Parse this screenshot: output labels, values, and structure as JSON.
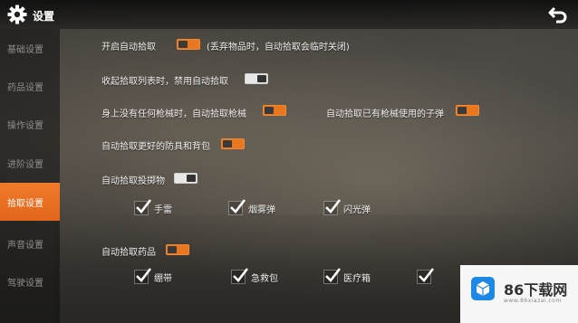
{
  "header": {
    "title": "设置"
  },
  "sidebar": {
    "items": [
      {
        "label": "基础设置",
        "active": false
      },
      {
        "label": "药品设置",
        "active": false
      },
      {
        "label": "操作设置",
        "active": false
      },
      {
        "label": "进阶设置",
        "active": false
      },
      {
        "label": "拾取设置",
        "active": true
      },
      {
        "label": "声音设置",
        "active": false
      },
      {
        "label": "驾驶设置",
        "active": false
      }
    ]
  },
  "settings": {
    "auto_pickup": {
      "label": "开启自动拾取",
      "state": "on",
      "note": "(丢弃物品时，自动拾取会临时关闭)"
    },
    "disable_when_list_collapsed": {
      "label": "收起拾取列表时，禁用自动拾取",
      "state": "off"
    },
    "auto_pickup_gun": {
      "label": "身上没有任何枪械时，自动拾取枪械",
      "state": "on"
    },
    "auto_pickup_ammo": {
      "label": "自动拾取已有枪械使用的子弹",
      "state": "on"
    },
    "auto_pickup_better_armor": {
      "label": "自动拾取更好的防具和背包",
      "state": "on"
    },
    "auto_pickup_throwables": {
      "label": "自动拾取投掷物",
      "state": "off",
      "options": [
        {
          "label": "手雷",
          "checked": true
        },
        {
          "label": "烟雾弹",
          "checked": true
        },
        {
          "label": "闪光弹",
          "checked": true
        }
      ]
    },
    "auto_pickup_medicine": {
      "label": "自动拾取药品",
      "state": "on",
      "options": [
        {
          "label": "绷带",
          "checked": true
        },
        {
          "label": "急救包",
          "checked": true
        },
        {
          "label": "医疗箱",
          "checked": true
        },
        {
          "label": "",
          "checked": true
        }
      ]
    }
  },
  "watermark": {
    "text": "86下载网",
    "sub": "www.86xiazai.com"
  },
  "colors": {
    "accent": "#e8771f",
    "active_tab": "#f07a2a"
  }
}
